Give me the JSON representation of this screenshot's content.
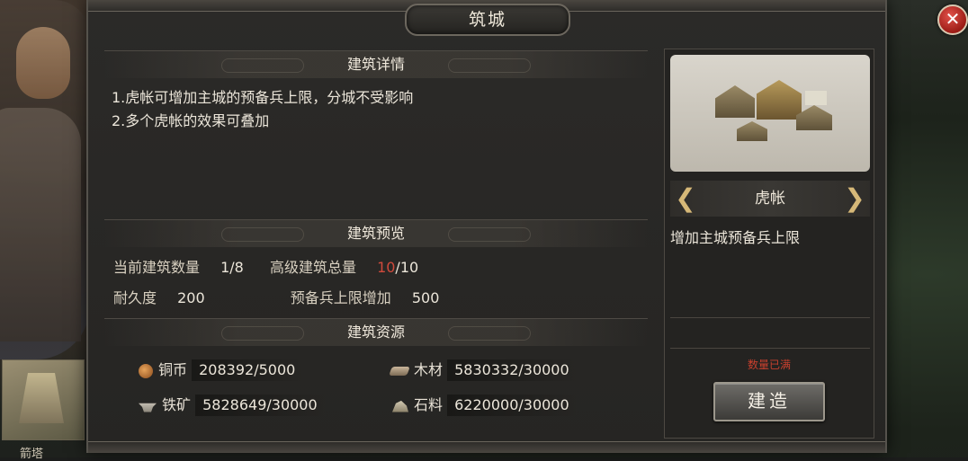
{
  "background": {
    "thumb_label": "箭塔"
  },
  "dialog": {
    "title": "筑城",
    "close_icon": "close-icon"
  },
  "details": {
    "header": "建筑详情",
    "lines": [
      "1.虎帐可增加主城的预备兵上限，分城不受影响",
      "2.多个虎帐的效果可叠加"
    ]
  },
  "preview": {
    "header": "建筑预览",
    "current_count_label": "当前建筑数量",
    "current_count_value": "1/8",
    "advanced_total_label": "高级建筑总量",
    "advanced_total_current": "10",
    "advanced_total_max": "/10",
    "durability_label": "耐久度",
    "durability_value": "200",
    "reserve_label": "预备兵上限增加",
    "reserve_value": "500"
  },
  "resources": {
    "header": "建筑资源",
    "items": [
      {
        "icon": "copper-coin-icon",
        "name": "铜币",
        "value": "208392/5000"
      },
      {
        "icon": "wood-icon",
        "name": "木材",
        "value": "5830332/30000"
      },
      {
        "icon": "iron-ore-icon",
        "name": "铁矿",
        "value": "5828649/30000"
      },
      {
        "icon": "stone-icon",
        "name": "石料",
        "value": "6220000/30000"
      }
    ]
  },
  "building": {
    "name": "虎帐",
    "description": "增加主城预备兵上限",
    "status": "数量已满",
    "build_label": "建造"
  },
  "colors": {
    "accent_red": "#d04a3c",
    "close_red": "#c0302a",
    "arrow_gold": "#d6b878"
  }
}
